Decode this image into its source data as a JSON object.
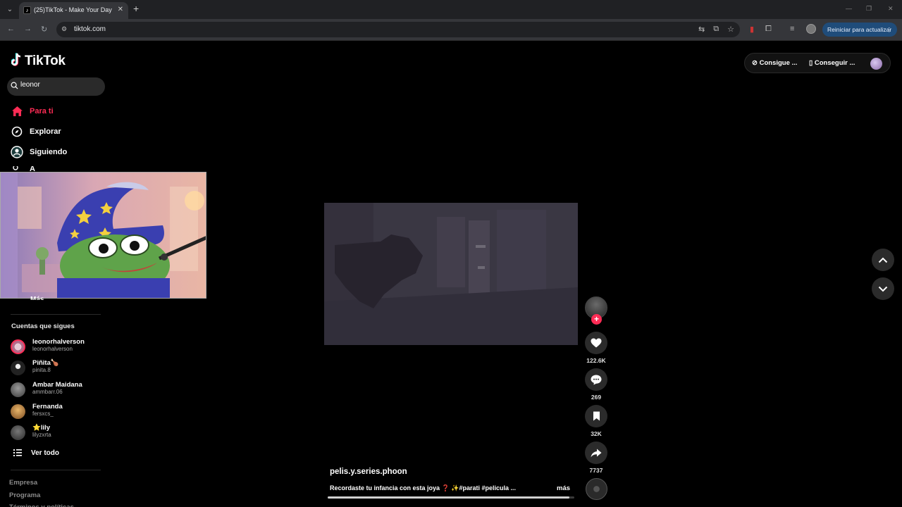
{
  "browser": {
    "tab_title": "(25)TikTok - Make Your Day",
    "url": "tiktok.com",
    "update_button": "Reiniciar para actualizar"
  },
  "sidebar": {
    "logo_text": "TikTok",
    "search_value": "leonor",
    "nav": [
      {
        "label": "Para ti",
        "icon": "home-icon",
        "active": true
      },
      {
        "label": "Explorar",
        "icon": "compass-icon",
        "active": false
      },
      {
        "label": "Siguiendo",
        "icon": "following-icon",
        "active": false
      }
    ],
    "nav_partial_label": "A",
    "more_partial_label": "Más",
    "following_title": "Cuentas que sigues",
    "accounts": [
      {
        "name": "leonorhalverson",
        "handle": "leonorhalverson"
      },
      {
        "name": "Piñita🍗",
        "handle": "pinita.8"
      },
      {
        "name": "Ambar Maidana",
        "handle": "ammbarr.06"
      },
      {
        "name": "Fernanda",
        "handle": "fersxcs_"
      },
      {
        "name": "⭐lily",
        "handle": "lilyzxrta"
      }
    ],
    "see_all": "Ver todo",
    "footer": [
      "Empresa",
      "Programa",
      "Términos y políticas"
    ]
  },
  "header": {
    "btn_1": "Consigue ...",
    "btn_2": "Conseguir ..."
  },
  "video": {
    "author": "pelis.y.series.phoon",
    "description": "Recordaste tu infancia con esta joya ❓ ✨#parati #pelicula ...",
    "more": "más",
    "likes": "122.6K",
    "comments": "269",
    "saves": "32K",
    "shares": "7737",
    "progress": 0.98
  },
  "colors": {
    "accent": "#fe2c55",
    "background": "#000000"
  }
}
